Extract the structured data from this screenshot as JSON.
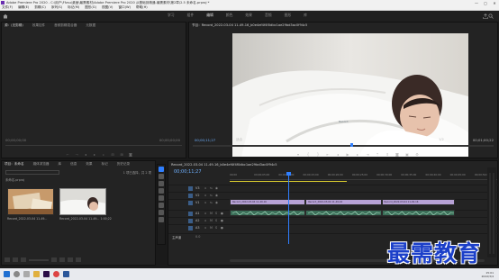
{
  "window": {
    "title": "Adobe Premiere Pro 2020 - C:\\用户\\Ffzsu\\桌面\\最需素材\\Adobe Premiere Pro 2020 从基础到精通-最需素材\\第2章\\2.5 未命名.prproj *",
    "controls": [
      "—",
      "▢",
      "✕"
    ]
  },
  "menu": [
    "文件(F)",
    "编辑(E)",
    "剪辑(C)",
    "序列(S)",
    "标记(M)",
    "图形(G)",
    "视图(V)",
    "窗口(W)",
    "帮助(H)"
  ],
  "workspaces": {
    "tabs": [
      "学习",
      "组件",
      "编辑",
      "颜色",
      "效果",
      "音频",
      "图形",
      "库"
    ],
    "active_index": 2
  },
  "source_panel": {
    "tabs": [
      "源：(无剪辑)",
      "效果控件",
      "音频剪辑混合器",
      "元数据"
    ],
    "timecode_left": "00;00;00;00",
    "timecode_right": "00;00;00;00"
  },
  "program_panel": {
    "tab": "节目：Record_2022-03-04 11-49-16_b0e4ef4f4f0dbc1ae29bd3ac0f94c5",
    "timecode_left": "00;00;11;27",
    "fit": "适合",
    "quality": "1/2",
    "timecode_right": "00;01;00;22",
    "video_watermark": "Record",
    "playhead_fraction": 0.52
  },
  "project_panel": {
    "tabs": [
      "项目：未命名",
      "媒体浏览器",
      "库",
      "信息",
      "效果",
      "标记",
      "历史记录"
    ],
    "file": "未命名.prproj",
    "count": "1 项已选择，共 2 项",
    "items": [
      {
        "label": "Record_2022-03-04 11-49...",
        "duration": "",
        "selected": false
      },
      {
        "label": "Record_2022-03-04 11-49...",
        "duration": "1:00;22",
        "selected": true
      }
    ]
  },
  "timeline": {
    "tab": "Record_2022-03-04 11-49-16_b0e4ef4f4f0dbc1ae29bd3ac0f94c5",
    "timecode": "00;00;11;27",
    "ruler_ticks": [
      "00;00",
      "00;00;05;00",
      "00;00;10;00",
      "00;00;15;00",
      "00;00;20;00",
      "00;00;25;00",
      "00;00;30;00",
      "00;00;35;00",
      "00;00;40;00",
      "00;00;45;00",
      "00;00;50;00"
    ],
    "tracks": [
      {
        "name": "V3",
        "type": "video"
      },
      {
        "name": "V2",
        "type": "video"
      },
      {
        "name": "V1",
        "type": "video"
      },
      {
        "name": "A1",
        "type": "audio"
      },
      {
        "name": "A2",
        "type": "audio"
      },
      {
        "name": "A3",
        "type": "audio"
      },
      {
        "name": "主声道",
        "type": "master",
        "value": "0.0"
      }
    ],
    "clips": [
      {
        "track": "V1",
        "label": "Record_2022-03-04 11-49-16",
        "start": 0,
        "end": 15.5
      },
      {
        "track": "V1",
        "label": "Record_2022-03-04 11-49-16",
        "start": 15.5,
        "end": 31
      },
      {
        "track": "V1",
        "label": "Record_2022-03-04 11-49-16",
        "start": 31,
        "end": 46
      },
      {
        "track": "A1",
        "label": "",
        "start": 0,
        "end": 15.5
      },
      {
        "track": "A1",
        "label": "",
        "start": 15.5,
        "end": 31
      },
      {
        "track": "A1",
        "label": "",
        "start": 31,
        "end": 46
      }
    ]
  },
  "taskbar": {
    "time": "15:01",
    "date": "2022/3/4"
  },
  "watermark": "最需教育",
  "colors": {
    "timecode_blue": "#6fb1ff",
    "playhead": "#2f7fff",
    "video_clip": "#b7a2d6",
    "audio_clip": "#3b6e58",
    "watermark": "#1b3fc9"
  }
}
